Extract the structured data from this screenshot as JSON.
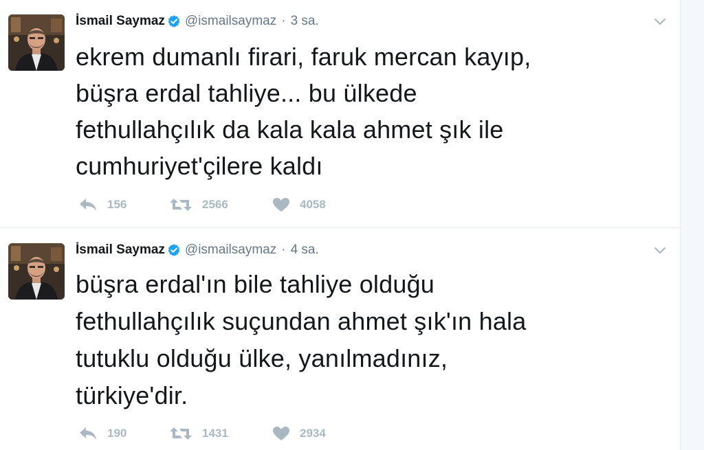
{
  "tweets": [
    {
      "name": "İsmail Saymaz",
      "handle": "@ismailsaymaz",
      "separator": "·",
      "time": "3 sa.",
      "text": "ekrem dumanlı firari, faruk mercan kayıp,\nbüşra erdal tahliye... bu ülkede\nfethullahçılık da kala kala ahmet şık ile\ncumhuriyet'çilere kaldı",
      "replies": "156",
      "retweets": "2566",
      "likes": "4058"
    },
    {
      "name": "İsmail Saymaz",
      "handle": "@ismailsaymaz",
      "separator": "·",
      "time": "4 sa.",
      "text": "büşra erdal'ın bile tahliye olduğu\nfethullahçılık suçundan ahmet şık'ın hala\ntutuklu olduğu ülke, yanılmadınız,\ntürkiye'dir.",
      "replies": "190",
      "retweets": "1431",
      "likes": "2934"
    }
  ],
  "icons": {
    "verified": "verified-badge-icon",
    "caret": "chevron-down-icon",
    "reply": "reply-icon",
    "retweet": "retweet-icon",
    "like": "heart-icon"
  },
  "colors": {
    "verified": "#1da1f2",
    "action_gray": "#aab8c2",
    "meta_gray": "#657786",
    "text": "#14171a",
    "divider": "#e6ecf0"
  }
}
